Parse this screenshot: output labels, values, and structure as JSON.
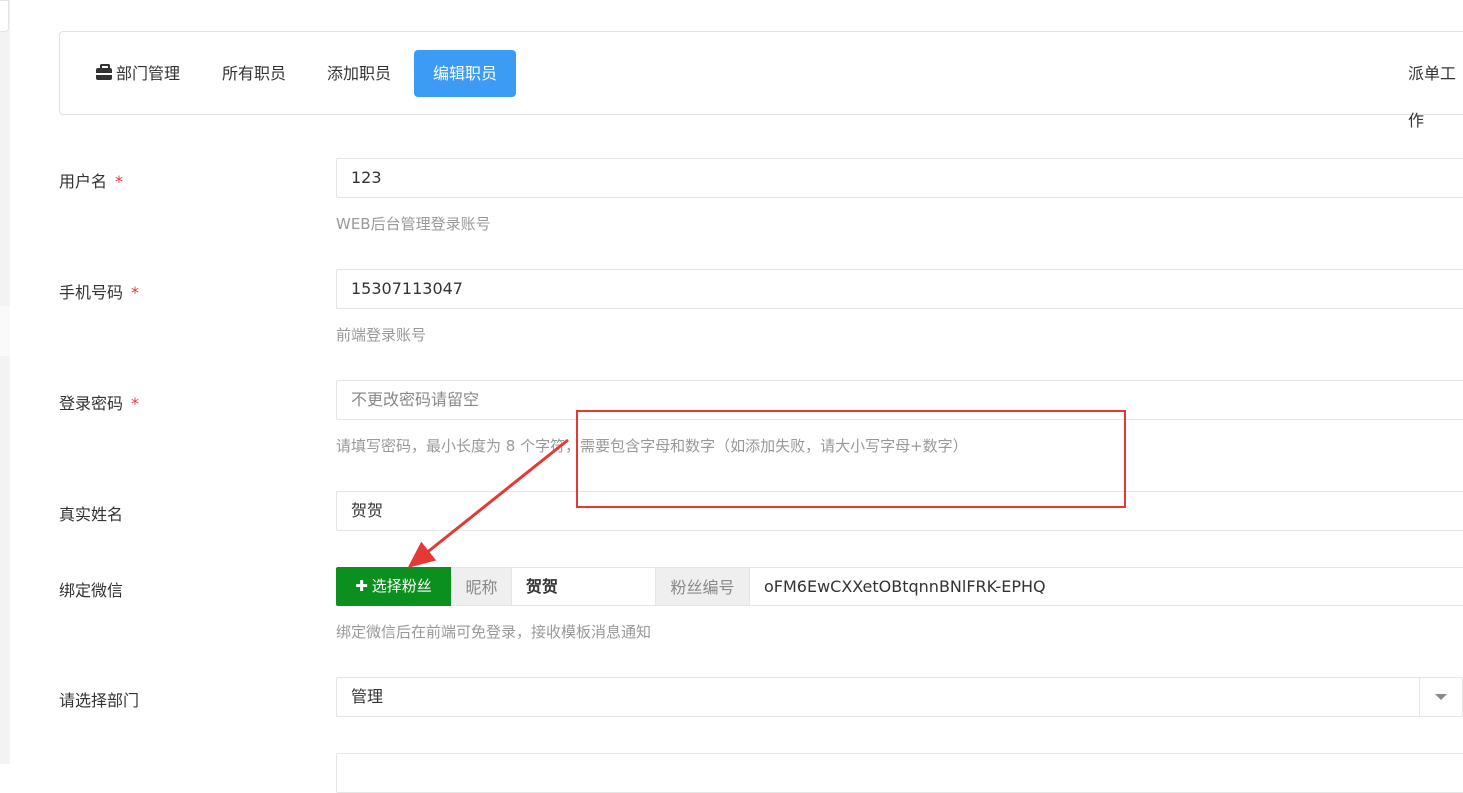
{
  "tabs": [
    {
      "label": "部门管理",
      "icon": "briefcase-icon"
    },
    {
      "label": "所有职员"
    },
    {
      "label": "添加职员"
    },
    {
      "label": "编辑职员",
      "active": true
    }
  ],
  "right_tab_label": "派单工作",
  "form": {
    "username": {
      "label": "用户名",
      "required": "*",
      "value": "123",
      "help": "WEB后台管理登录账号"
    },
    "phone": {
      "label": "手机号码",
      "required": "*",
      "value": "15307113047",
      "help": "前端登录账号"
    },
    "password": {
      "label": "登录密码",
      "required": "*",
      "placeholder": "不更改密码请留空",
      "help": "请填写密码，最小长度为 8 个字符，需要包含字母和数字（如添加失败，请大小写字母+数字）"
    },
    "realname": {
      "label": "真实姓名",
      "value": "贺贺"
    },
    "wechat": {
      "label": "绑定微信",
      "button_label": "选择粉丝",
      "button_icon": "plus-icon",
      "nickname_addon": "昵称",
      "nickname_value": "贺贺",
      "fan_id_addon": "粉丝编号",
      "fan_id_value": "oFM6EwCXXetOBtqnnBNlFRK-EPHQ",
      "help": "绑定微信后在前端可免登录，接收模板消息通知"
    },
    "department": {
      "label": "请选择部门",
      "value": "管理",
      "icon": "caret-down-icon"
    }
  },
  "colors": {
    "primary": "#3c9cf5",
    "wechat_green": "#0b8f1e",
    "annotation_red": "#e53935",
    "required_red": "#e4393c"
  }
}
